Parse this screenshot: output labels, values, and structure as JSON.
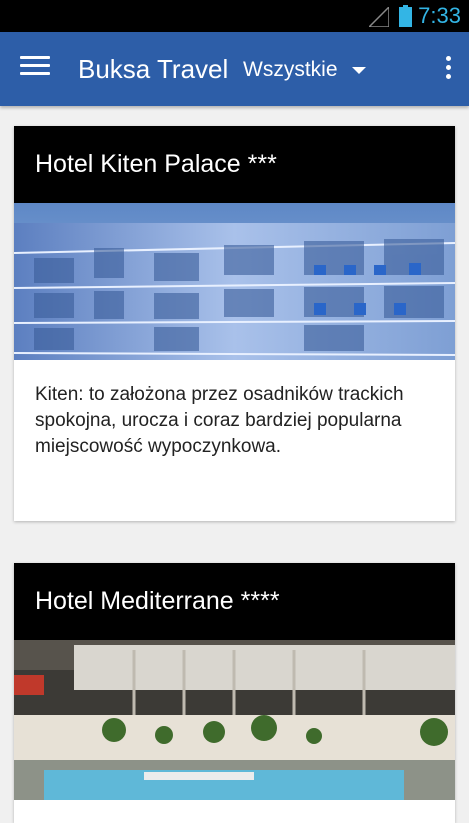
{
  "status_bar": {
    "time": "7:33",
    "signal_icon": "signal-icon",
    "battery_icon": "battery-icon"
  },
  "app_bar": {
    "title": "Buksa Travel",
    "filter_label": "Wszystkie",
    "menu_icon": "hamburger-menu-icon",
    "overflow_icon": "overflow-menu-icon",
    "color": "#2d5ea8"
  },
  "cards": [
    {
      "title": "Hotel Kiten Palace ***",
      "description": "Kiten: to założona przez osadników trackich spokojna, urocza i coraz bardziej popularna miejscowość wypoczynkowa."
    },
    {
      "title": "Hotel Mediterrane ****"
    }
  ]
}
